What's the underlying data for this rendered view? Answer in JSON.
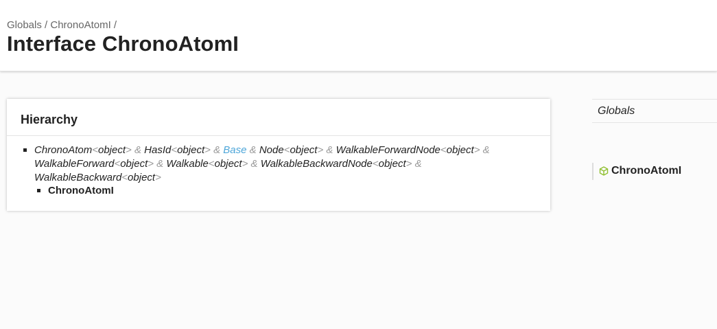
{
  "breadcrumb": {
    "items": [
      "Globals",
      "ChronoAtomI"
    ],
    "separator": "/"
  },
  "page": {
    "title": "Interface ChronoAtomI"
  },
  "hierarchy": {
    "heading": "Hierarchy",
    "types": [
      {
        "name": "ChronoAtom",
        "generic": "object"
      },
      {
        "name": "HasId",
        "generic": "object"
      },
      {
        "name": "Base",
        "link": true
      },
      {
        "name": "Node",
        "generic": "object"
      },
      {
        "name": "WalkableForwardNode",
        "generic": "object"
      },
      {
        "name": "WalkableForward",
        "generic": "object"
      },
      {
        "name": "Walkable",
        "generic": "object"
      },
      {
        "name": "WalkableBackwardNode",
        "generic": "object"
      },
      {
        "name": "WalkableBackward",
        "generic": "object"
      }
    ],
    "punct": {
      "lt": "<",
      "gt": ">",
      "amp": "&"
    },
    "child": "ChronoAtomI"
  },
  "sidebar": {
    "globals": "Globals",
    "current": {
      "label": "ChronoAtomI",
      "icon": "interface-cube-icon",
      "icon_color": "#8fbf2f"
    }
  },
  "colors": {
    "link": "#4da6d9",
    "muted": "#999999"
  }
}
